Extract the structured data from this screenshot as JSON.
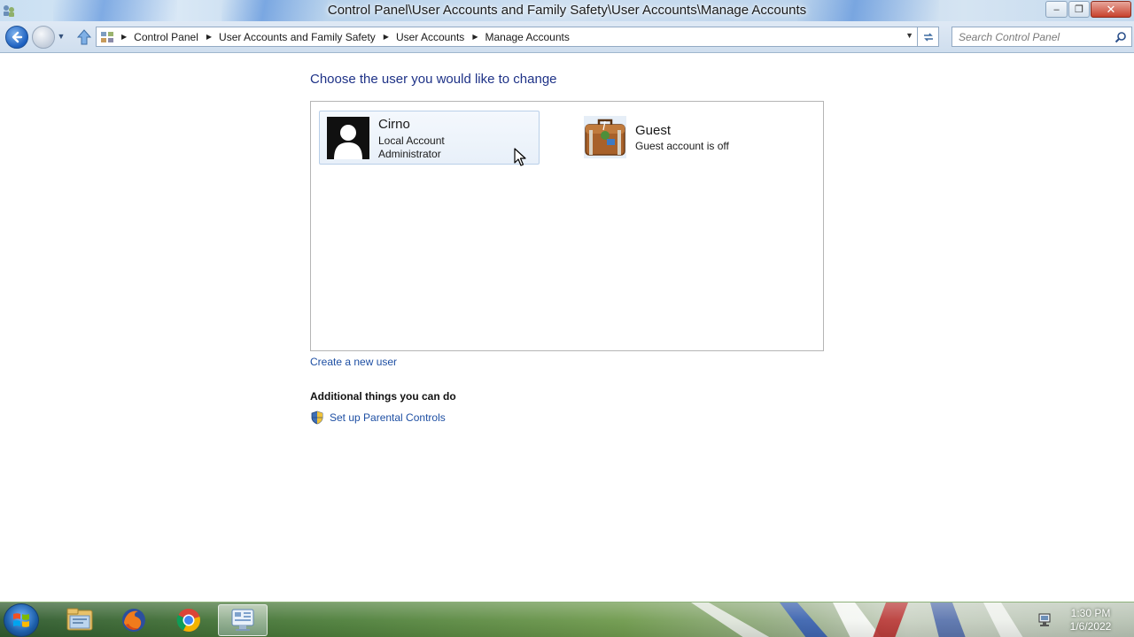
{
  "window": {
    "title": "Control Panel\\User Accounts and Family Safety\\User Accounts\\Manage Accounts",
    "minimize_label": "–",
    "restore_label": "❐",
    "close_label": "✕"
  },
  "address_bar": {
    "breadcrumbs": [
      {
        "label": "Control Panel"
      },
      {
        "label": "User Accounts and Family Safety"
      },
      {
        "label": "User Accounts"
      },
      {
        "label": "Manage Accounts"
      }
    ],
    "separator": "▶",
    "search_placeholder": "Search Control Panel"
  },
  "main": {
    "heading": "Choose the user you would like to change",
    "accounts": [
      {
        "name": "Cirno",
        "line1": "Local Account",
        "line2": "Administrator",
        "icon": "person-silhouette-icon"
      },
      {
        "name": "Guest",
        "line1": "Guest account is off",
        "icon": "suitcase-icon"
      }
    ],
    "create_link": "Create a new user",
    "additional_heading": "Additional things you can do",
    "parental_controls_link": "Set up Parental Controls"
  },
  "taskbar": {
    "apps": [
      {
        "name": "windows-explorer",
        "icon": "folder-icon"
      },
      {
        "name": "firefox",
        "icon": "firefox-icon"
      },
      {
        "name": "chrome",
        "icon": "chrome-icon"
      },
      {
        "name": "control-panel",
        "icon": "control-panel-icon",
        "active": true
      }
    ],
    "clock": {
      "time": "1:30 PM",
      "date": "1/6/2022"
    }
  },
  "colors": {
    "link": "#1e4fa3",
    "heading": "#1e3287",
    "taskbar_green": "#4e7f3b"
  }
}
